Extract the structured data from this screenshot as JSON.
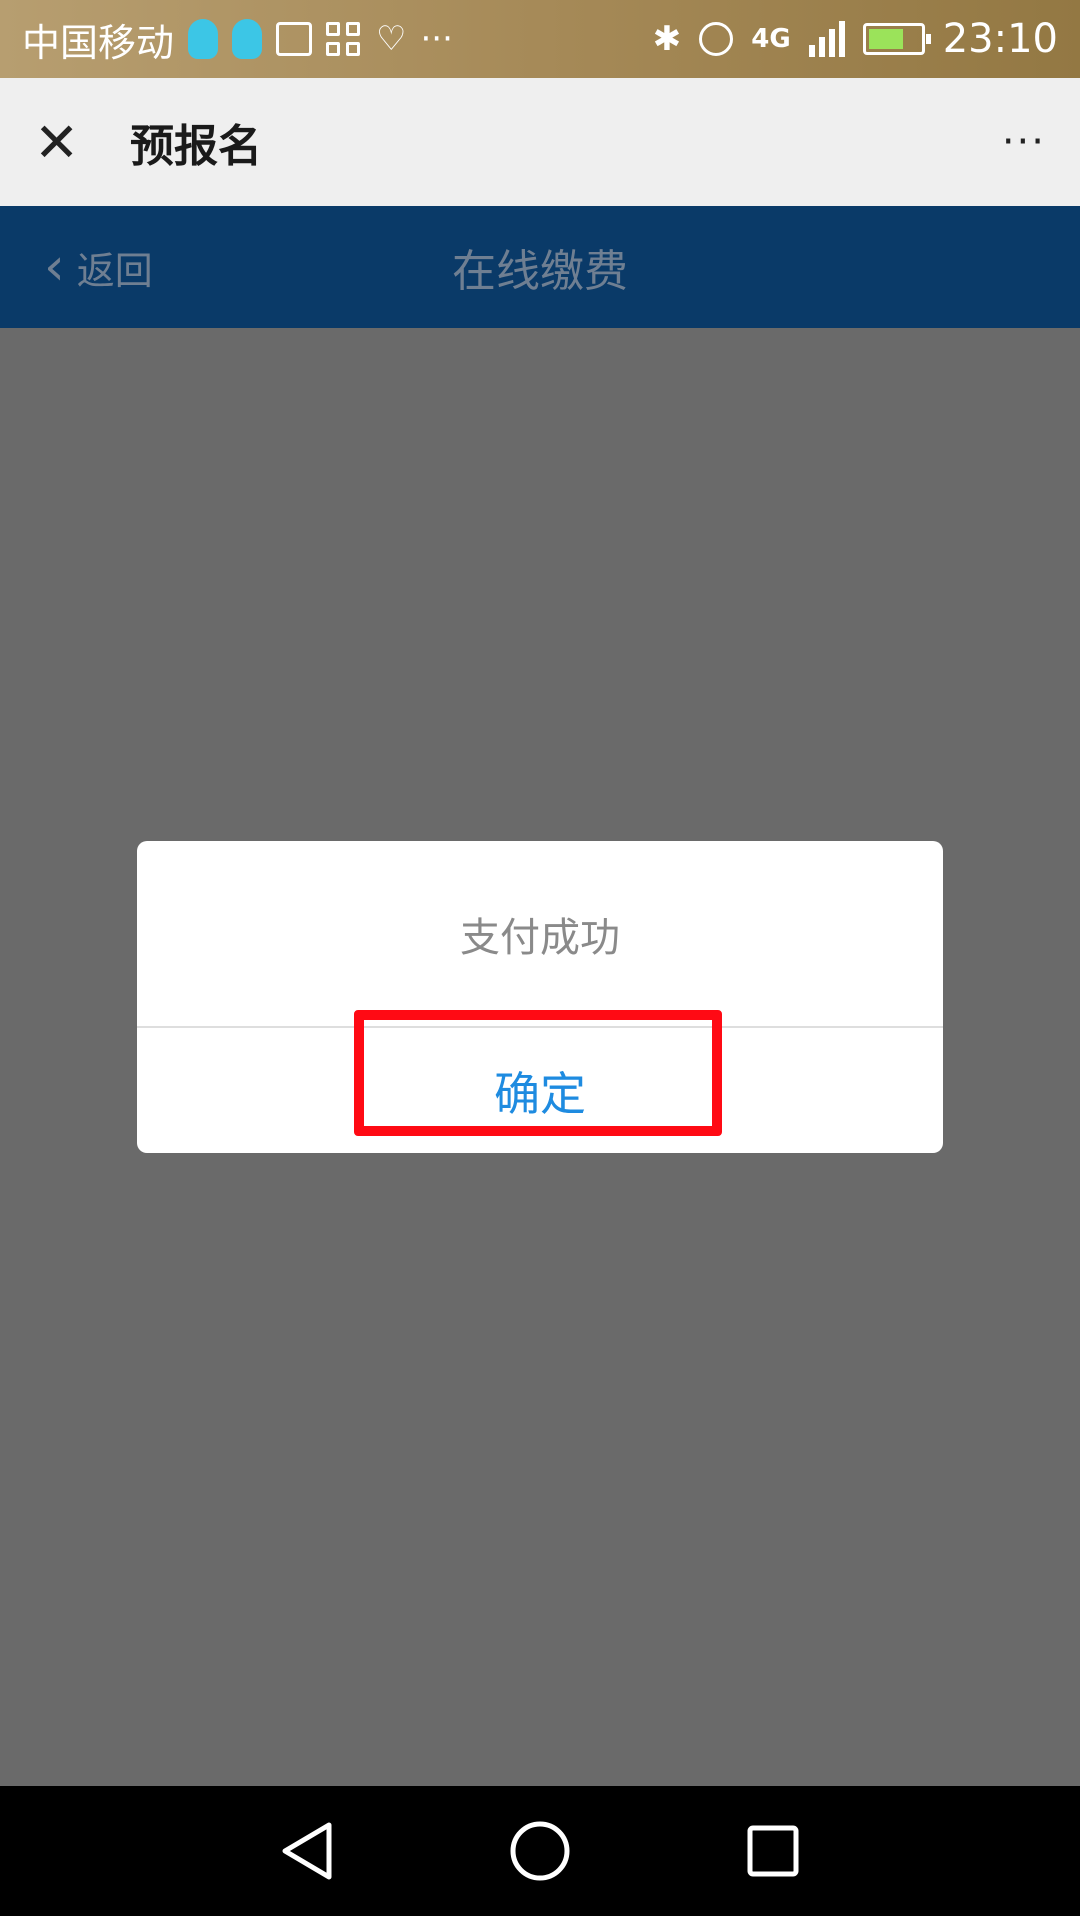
{
  "status_bar": {
    "carrier": "中国移动",
    "more": "···",
    "network": "4G",
    "time": "23:10"
  },
  "titlebar": {
    "title": "预报名",
    "more": "···"
  },
  "page_header": {
    "back_label": "返回",
    "title": "在线缴费"
  },
  "dialog": {
    "message": "支付成功",
    "ok_label": "确定",
    "ok_color": "#1e8be0",
    "highlight_color": "#ff0a14"
  },
  "colors": {
    "header_bg": "#0a3a68",
    "overlay_bg": "#6a6a6a"
  }
}
